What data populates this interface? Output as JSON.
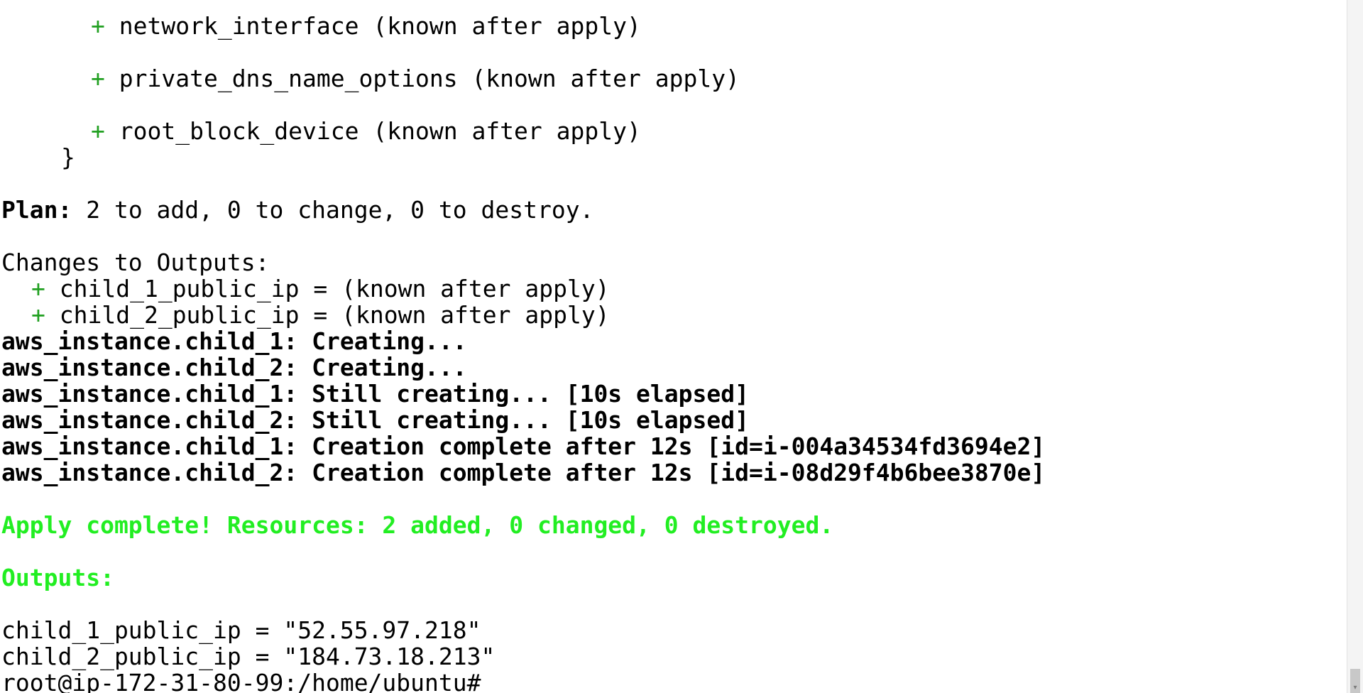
{
  "terminal": {
    "plus_sign": "+",
    "lines": {
      "network_interface": "network_interface (known after apply)",
      "private_dns": "private_dns_name_options (known after apply)",
      "root_block": "root_block_device (known after apply)",
      "closing_brace": "}",
      "plan_label": "Plan:",
      "plan_text": " 2 to add, 0 to change, 0 to destroy.",
      "changes_header": "Changes to Outputs:",
      "out1_change": "child_1_public_ip = (known after apply)",
      "out2_change": "child_2_public_ip = (known after apply)",
      "create1": "aws_instance.child_1: Creating...",
      "create2": "aws_instance.child_2: Creating...",
      "still1": "aws_instance.child_1: Still creating... [10s elapsed]",
      "still2": "aws_instance.child_2: Still creating... [10s elapsed]",
      "complete1": "aws_instance.child_1: Creation complete after 12s [id=i-004a34534fd3694e2]",
      "complete2": "aws_instance.child_2: Creation complete after 12s [id=i-08d29f4b6bee3870e]",
      "apply_complete": "Apply complete! Resources: 2 added, 0 changed, 0 destroyed.",
      "outputs_header": "Outputs:",
      "out1_value": "child_1_public_ip = \"52.55.97.218\"",
      "out2_value": "child_2_public_ip = \"184.73.18.213\"",
      "prompt": "root@ip-172-31-80-99:/home/ubuntu#"
    }
  },
  "scrollbar": {
    "arrow_icon": "▾"
  },
  "colors": {
    "background": "#ffffff",
    "text": "#000000",
    "plus": "#22a022",
    "success": "#22ee22"
  }
}
